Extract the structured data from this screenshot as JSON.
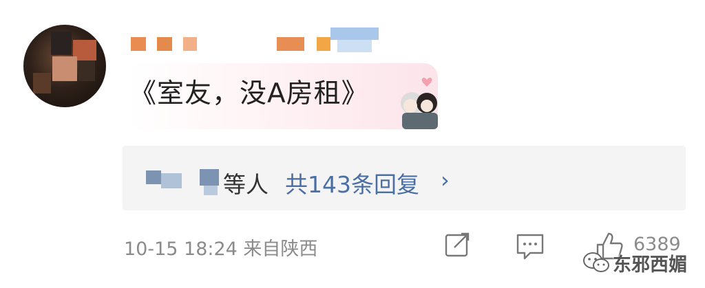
{
  "comment": {
    "text": "《室友，没A房租》"
  },
  "replies": {
    "suffix": "等人",
    "count_text": "共143条回复",
    "chevron": "›"
  },
  "meta": {
    "timestamp_location": "10-15 18:24 来自陕西",
    "likes": "6389"
  },
  "icons": [
    "share-icon",
    "comment-icon",
    "like-icon",
    "wechat-icon"
  ],
  "watermark": {
    "text": "东邪西媚"
  },
  "colors": {
    "link": "#4a6fa5",
    "meta": "#8b8b8b",
    "reply_bg": "#f4f4f4"
  }
}
